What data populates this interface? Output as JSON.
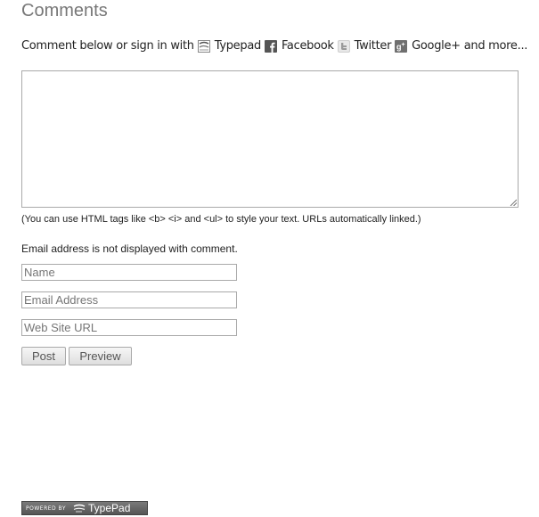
{
  "comments": {
    "heading": "Comments",
    "signin_prefix": "Comment below or sign in with",
    "services": [
      {
        "name": "Typepad",
        "icon": "typepad-icon"
      },
      {
        "name": "Facebook",
        "icon": "facebook-icon"
      },
      {
        "name": "Twitter",
        "icon": "twitter-icon"
      },
      {
        "name": "Google+",
        "icon": "googleplus-icon"
      }
    ],
    "more_label": "and more...",
    "textarea_value": "",
    "html_hint": "(You can use HTML tags like <b> <i> and <ul> to style your text. URLs automatically linked.)",
    "email_note": "Email address is not displayed with comment.",
    "fields": {
      "name_placeholder": "Name",
      "email_placeholder": "Email Address",
      "url_placeholder": "Web Site URL"
    },
    "buttons": {
      "post": "Post",
      "preview": "Preview"
    },
    "powered": {
      "prefix": "POWERED BY",
      "brand": "TypePad"
    }
  },
  "colors": {
    "facebook": "#555555",
    "twitter": "#a7a7a7",
    "googleplus": "#6f6f6f"
  }
}
